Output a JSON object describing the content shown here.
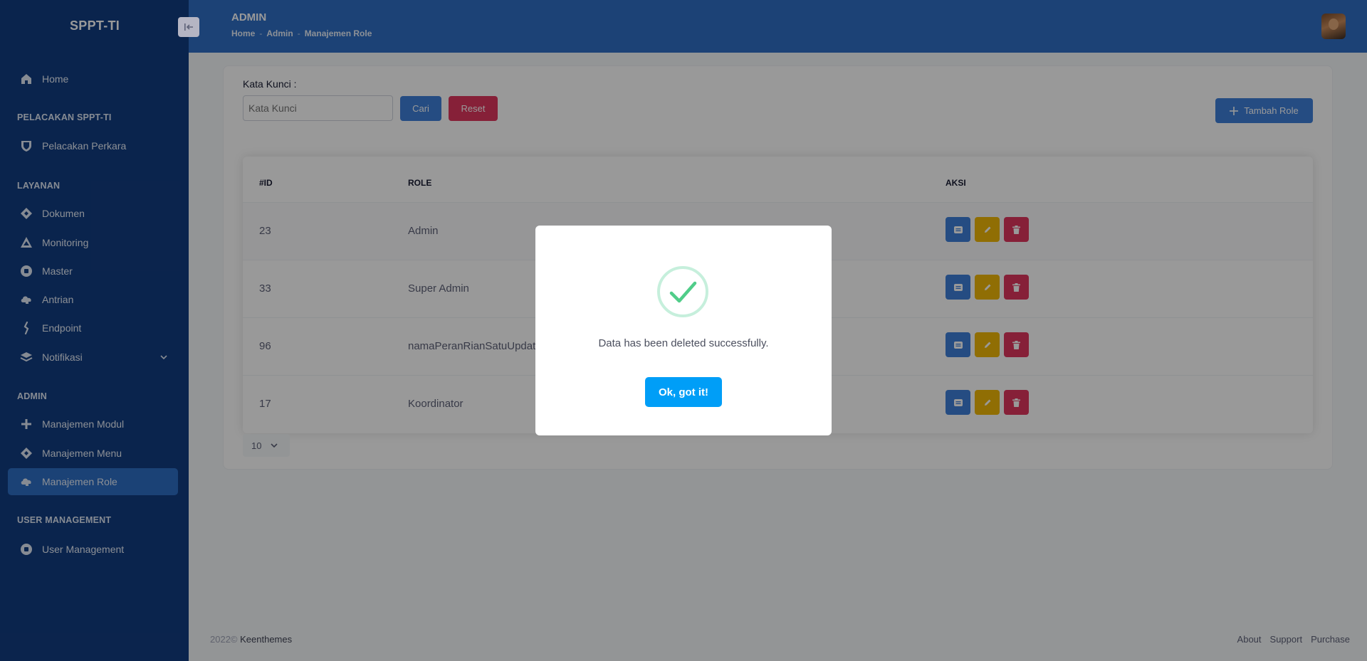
{
  "sidebar": {
    "brand": "SPPT-TI",
    "collapse_icon": "arrow-to-left-icon",
    "home_label": "Home",
    "sections": {
      "pelacakan": "PELACAKAN SPPT-TI",
      "layanan": "LAYANAN",
      "admin": "ADMIN",
      "user_management": "USER MANAGEMENT"
    },
    "items": {
      "pelacakan_perkara": "Pelacakan Perkara",
      "dokumen": "Dokumen",
      "monitoring": "Monitoring",
      "master": "Master",
      "antrian": "Antrian",
      "endpoint": "Endpoint",
      "notifikasi": "Notifikasi",
      "manajemen_modul": "Manajemen Modul",
      "manajemen_menu": "Manajemen Menu",
      "manajemen_role": "Manajemen Role",
      "user_management": "User Management"
    },
    "active_item": "Manajemen Role"
  },
  "header": {
    "title": "ADMIN",
    "breadcrumb": [
      "Home",
      "Admin",
      "Manajemen Role"
    ],
    "breadcrumb_sep": "-"
  },
  "search": {
    "label": "Kata Kunci :",
    "placeholder": "Kata Kunci",
    "search_label": "Cari",
    "reset_label": "Reset",
    "add_label": "Tambah Role"
  },
  "table": {
    "columns": [
      "#ID",
      "ROLE",
      "AKSI"
    ],
    "rows": [
      {
        "id": "23",
        "role": "Admin"
      },
      {
        "id": "33",
        "role": "Super Admin"
      },
      {
        "id": "96",
        "role": "namaPeranRianSatuUpdate"
      },
      {
        "id": "17",
        "role": "Koordinator"
      }
    ]
  },
  "pagination": {
    "page_size": "10"
  },
  "footer": {
    "year": "2022©",
    "brand": "Keenthemes",
    "links": [
      "About",
      "Support",
      "Purchase"
    ]
  },
  "modal": {
    "message": "Data has been deleted successfully.",
    "confirm_label": "Ok, got it!",
    "icon": "success-check-icon"
  },
  "colors": {
    "sidebar_bg": "#123c80",
    "header_bg": "#2f6ec5",
    "primary": "#3e7fd9",
    "danger": "#e0365e",
    "warning": "#f0b807",
    "modal_button": "#009ef7",
    "success": "#50cd89"
  }
}
